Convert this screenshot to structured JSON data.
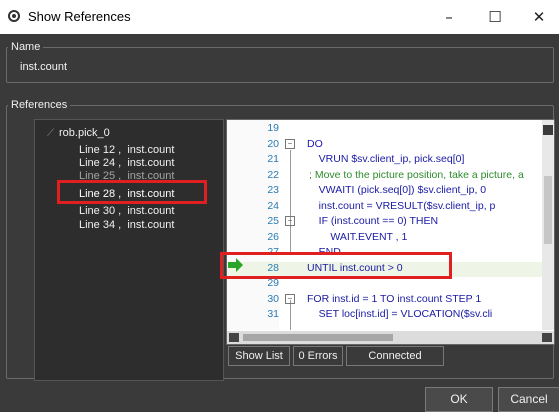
{
  "window": {
    "title": "Show References",
    "minimize_glyph": "–",
    "maximize_glyph": "☐",
    "close_glyph": "✕"
  },
  "name_group": {
    "legend": "Name",
    "value": "inst.count"
  },
  "references_group": {
    "legend": "References",
    "tree": {
      "root": "rob.pick_0",
      "items": [
        "Line 12 ,  inst.count",
        "Line 24 ,  inst.count",
        "Line 25 ,  inst.count",
        "Line 28 ,  inst.count",
        "Line 30 ,  inst.count",
        "Line 34 ,  inst.count"
      ],
      "selected_index": 3
    }
  },
  "code": {
    "lines": [
      {
        "num": "19",
        "text": ""
      },
      {
        "num": "20",
        "text": "DO"
      },
      {
        "num": "21",
        "text": "    VRUN $sv.client_ip, pick.seq[0]"
      },
      {
        "num": "22",
        "text": "; Move to the picture position, take a picture, a",
        "comment": true
      },
      {
        "num": "23",
        "text": "    VWAITI (pick.seq[0]) $sv.client_ip, 0"
      },
      {
        "num": "24",
        "text": "    inst.count = VRESULT($sv.client_ip, p"
      },
      {
        "num": "25",
        "text": "    IF (inst.count == 0) THEN"
      },
      {
        "num": "26",
        "text": "        WAIT.EVENT , 1"
      },
      {
        "num": "27",
        "text": "    END"
      },
      {
        "num": "28",
        "text": "UNTIL inst.count > 0"
      },
      {
        "num": "29",
        "text": ""
      },
      {
        "num": "30",
        "text": "FOR inst.id = 1 TO inst.count STEP 1"
      },
      {
        "num": "31",
        "text": "    SET loc[inst.id] = VLOCATION($sv.cli"
      }
    ],
    "current_line": "28",
    "current_line_color": "#2aa52a"
  },
  "status": {
    "show_list": "Show List",
    "errors": "0 Errors",
    "connection": "Connected"
  },
  "buttons": {
    "ok": "OK",
    "cancel": "Cancel"
  },
  "colors": {
    "highlight_box": "#e02020",
    "dialog_bg": "#3a3a3a",
    "keyword": "#1a1aa6",
    "comment": "#2e8b2e",
    "line_number": "#2b7bb5"
  }
}
